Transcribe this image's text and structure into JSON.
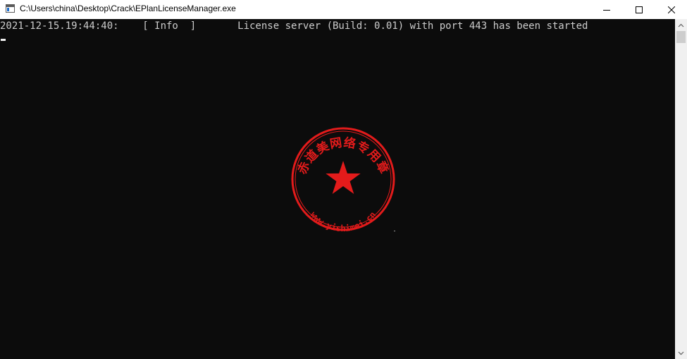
{
  "window": {
    "title": "C:\\Users\\china\\Desktop\\Crack\\EPlanLicenseManager.exe",
    "icons": {
      "app": "console-app-icon",
      "minimize": "minimize-icon",
      "maximize": "maximize-icon",
      "close": "close-icon"
    }
  },
  "console": {
    "lines": [
      "2021-12-15.19:44:40:    [ Info  ]       License server (Build: 0.01) with port 443 has been started"
    ],
    "text_color": "#cccccc",
    "background": "#0c0c0c"
  },
  "watermark": {
    "top_text": "赤道美网络专用章",
    "bottom_text": "www.yishimei.cn",
    "color": "#e31b1b"
  }
}
